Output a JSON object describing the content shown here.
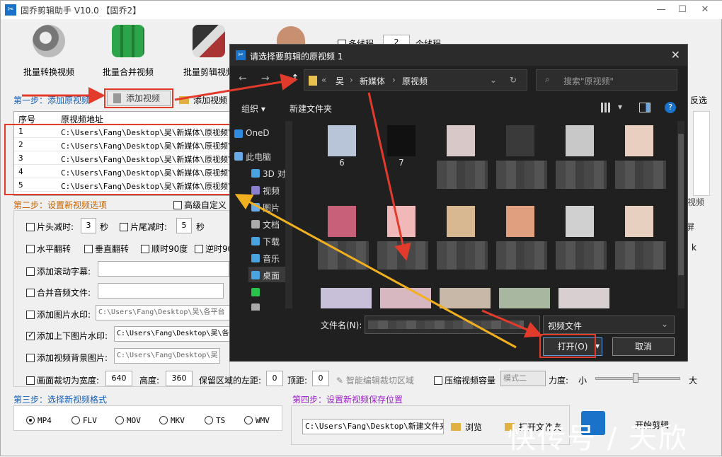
{
  "app": {
    "title": "固乔剪辑助手 V10.0  【固乔2】",
    "icon": "scissors-app-icon"
  },
  "window_controls": {
    "minimize": "—",
    "maximize": "☐",
    "close": "✕"
  },
  "toolbar": [
    {
      "label": "批量转换视频",
      "icon": "film-reel-icon",
      "color": "#7a3fb0"
    },
    {
      "label": "批量合并视频",
      "icon": "merge-blocks-icon",
      "color": "#2ca54a"
    },
    {
      "label": "批量剪辑视频",
      "icon": "film-strip-icon",
      "color": "#333333"
    }
  ],
  "threads": {
    "label": "多线程",
    "value": "2",
    "suffix": "个线程"
  },
  "step1": {
    "label": "第一步：添加原视频",
    "add_video": "添加视频",
    "add_video2": "添加视频",
    "invert": "反选"
  },
  "table": {
    "headers": [
      "序号",
      "原视频地址"
    ],
    "rows": [
      {
        "no": "1",
        "path": "C:\\Users\\Fang\\Desktop\\吴\\新媒体\\原视频\\6"
      },
      {
        "no": "2",
        "path": "C:\\Users\\Fang\\Desktop\\吴\\新媒体\\原视频\\6"
      },
      {
        "no": "3",
        "path": "C:\\Users\\Fang\\Desktop\\吴\\新媒体\\原视频\\6"
      },
      {
        "no": "4",
        "path": "C:\\Users\\Fang\\Desktop\\吴\\新媒体\\原视频\\6"
      },
      {
        "no": "5",
        "path": "C:\\Users\\Fang\\Desktop\\吴\\新媒体\\原视频\\6"
      }
    ]
  },
  "step2": {
    "label": "第二步：设置新视频选项",
    "advanced": "高级自定义",
    "head_cut": "片头减时:",
    "head_cut_val": "3",
    "sec": "秒",
    "tail_cut": "片尾减时:",
    "tail_cut_val": "5",
    "sec2": "秒",
    "hflip": "水平翻转",
    "vflip": "垂直翻转",
    "rot90": "顺时90度",
    "rot_ccw": "逆时90",
    "scroll_sub": "添加滚动字幕:",
    "merge_audio": "合并音频文件:",
    "img_watermark": "添加图片水印:",
    "img_watermark_path": "C:\\Users\\Fang\\Desktop\\吴\\各平台",
    "topbottom_img": "添加上下图片水印:",
    "topbottom_path": "C:\\Users\\Fang\\Desktop\\吴\\各",
    "bg_img": "添加视频背景图片:",
    "bg_path": "C:\\Users\\Fang\\Desktop\\吴",
    "crop": "画面裁切为宽度:",
    "crop_w": "640",
    "height_lbl": "高度:",
    "crop_h": "360",
    "keep_left": "保留区域的左距:",
    "left_val": "0",
    "top_lbl": "顶距:",
    "top_val": "0",
    "smart_crop": "智能编辑裁切区域",
    "compress": "压缩视频容量",
    "mode": "模式二",
    "strength": "力度:",
    "small": "小",
    "big": "大",
    "side_video": "视频",
    "side_screen": "屏",
    "side_k": "k"
  },
  "step3": {
    "label": "第三步：选择新视频格式",
    "formats": [
      "MP4",
      "FLV",
      "MOV",
      "MKV",
      "TS",
      "WMV"
    ],
    "selected": "MP4"
  },
  "step4": {
    "label": "第四步：设置新视频保存位置",
    "path": "C:\\Users\\Fang\\Desktop\\新建文件夹",
    "browse": "浏览",
    "open_folder": "打开文件夹",
    "start": "开始剪辑"
  },
  "dialog": {
    "title": "请选择要剪辑的原视频 1",
    "close": "✕",
    "breadcrumb": [
      "«",
      "吴",
      "新媒体",
      "原视频"
    ],
    "search_placeholder": "搜索\"原视频\"",
    "organize": "组织",
    "new_folder": "新建文件夹",
    "sidebar": [
      {
        "label": "OneD",
        "icon": "cloud-icon",
        "color": "#2f8ae0"
      },
      {
        "label": "此电脑",
        "icon": "computer-icon",
        "color": "#6aa9e8"
      },
      {
        "label": "3D 对",
        "icon": "cube-icon",
        "color": "#4aa3df"
      },
      {
        "label": "视频",
        "icon": "video-folder-icon",
        "color": "#8a7fd0"
      },
      {
        "label": "图片",
        "icon": "picture-folder-icon",
        "color": "#6aa9e8"
      },
      {
        "label": "文档",
        "icon": "document-folder-icon",
        "color": "#aaaaaa"
      },
      {
        "label": "下载",
        "icon": "download-icon",
        "color": "#4aa3df"
      },
      {
        "label": "音乐",
        "icon": "music-icon",
        "color": "#4aa3df"
      },
      {
        "label": "桌面",
        "icon": "desktop-icon",
        "color": "#4aa3df"
      },
      {
        "label": "",
        "icon": "wechat-icon",
        "color": "#2ac34a"
      },
      {
        "label": "文档",
        "icon": "document-icon",
        "color": "#aaaaaa"
      }
    ],
    "thumbs": [
      {
        "label": "6",
        "color": "#b8c4d8"
      },
      {
        "label": "7",
        "color": "#111111"
      },
      {
        "label": "",
        "color": "#d8c8c8"
      },
      {
        "label": "",
        "color": "#3a3a3a"
      },
      {
        "label": "",
        "color": "#c8c8c8"
      },
      {
        "label": "",
        "color": "#e8cfc0"
      },
      {
        "label": "",
        "color": "#c8607a"
      },
      {
        "label": "",
        "color": "#f0b8b8"
      },
      {
        "label": "",
        "color": "#d8b890"
      },
      {
        "label": "",
        "color": "#e0a080"
      },
      {
        "label": "",
        "color": "#d0d0d0"
      },
      {
        "label": "",
        "color": "#e8d0c0"
      },
      {
        "label": "",
        "color": "#c8c0d8"
      },
      {
        "label": "",
        "color": "#d8b8c0"
      },
      {
        "label": "",
        "color": "#c8b8a8"
      },
      {
        "label": "",
        "color": "#a8b8a0"
      },
      {
        "label": "",
        "color": "#d8d0d0"
      }
    ],
    "filename_label": "文件名(N):",
    "filetype": "视频文件",
    "open": "打开(O)",
    "cancel": "取消"
  },
  "watermark": "快传号 / 天欣",
  "colors": {
    "red_highlight": "#e23b2b",
    "arrow_yellow": "#f0b020",
    "step_blue": "#1560b8",
    "step_orange": "#c86400",
    "step_purple": "#9b1fc8"
  }
}
